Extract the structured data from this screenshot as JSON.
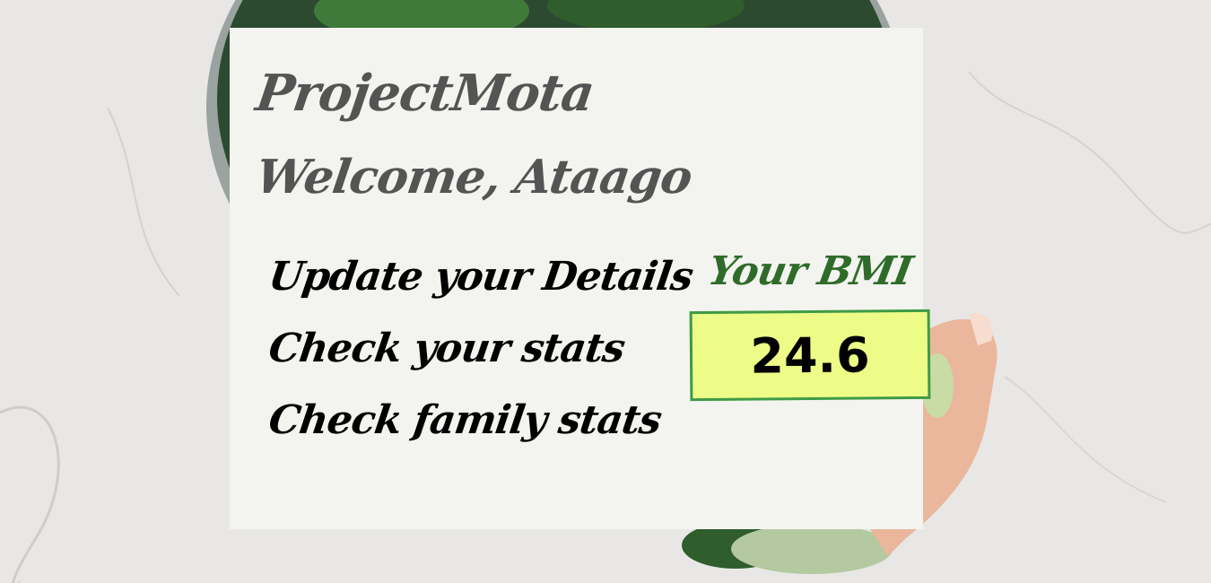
{
  "header": {
    "brand": "ProjectMota",
    "welcome": "Welcome, Ataago"
  },
  "menu": {
    "items": [
      {
        "label": "Update your Details"
      },
      {
        "label": "Check your stats"
      },
      {
        "label": "Check family stats"
      }
    ]
  },
  "bmi": {
    "label": "Your BMI",
    "value": "24.6"
  },
  "colors": {
    "card_background": "#f3f4ef",
    "bmi_box_fill": "#ecfc86",
    "bmi_box_border": "#3e9a46",
    "bmi_label": "#2f6b2a",
    "heading_text": "#545454"
  }
}
